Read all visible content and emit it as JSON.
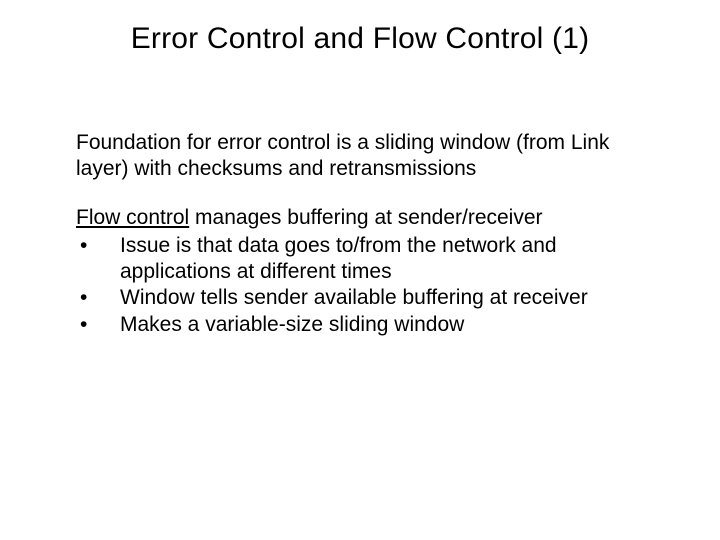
{
  "title": "Error Control and Flow Control (1)",
  "para1": "Foundation for error control is a sliding window (from Link layer) with checksums and retransmissions",
  "flow_label": "Flow control",
  "flow_rest": " manages buffering at sender/receiver",
  "bullets": {
    "mark": "•",
    "items": [
      "Issue is that data goes to/from the network and applications at different times",
      "Window tells sender available buffering at receiver",
      "Makes a variable-size sliding window"
    ]
  }
}
